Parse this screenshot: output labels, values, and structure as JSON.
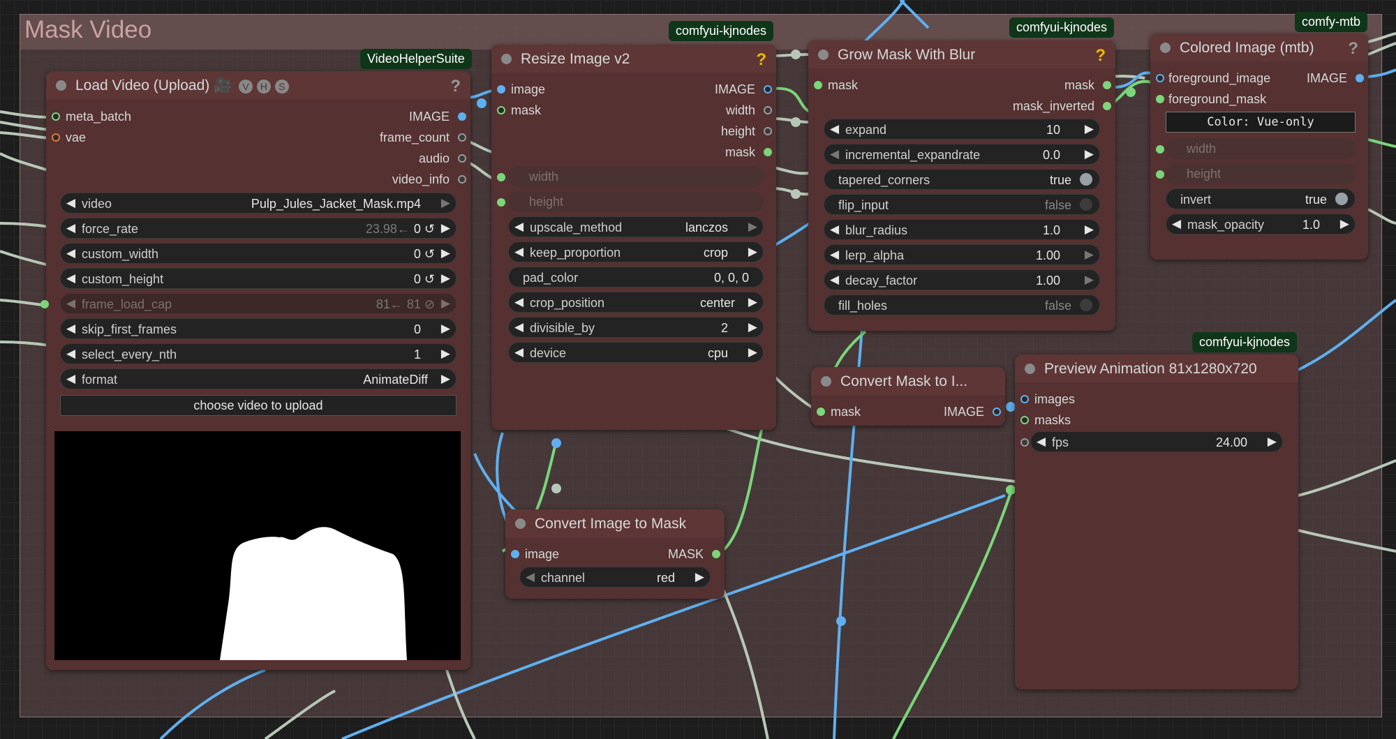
{
  "group": {
    "title": "Mask Video"
  },
  "badges": {
    "vhs": "VideoHelperSuite",
    "kj1": "comfyui-kjnodes",
    "kj2": "comfyui-kjnodes",
    "mtb": "comfy-mtb",
    "kj3": "comfyui-kjnodes"
  },
  "load_video": {
    "title": "Load Video (Upload) 🎥",
    "badge_letters": [
      "V",
      "H",
      "S"
    ],
    "help": "?",
    "inputs": [
      "meta_batch",
      "vae"
    ],
    "outputs": [
      "IMAGE",
      "frame_count",
      "audio",
      "video_info"
    ],
    "widgets": {
      "video": {
        "label": "video",
        "value": "Pulp_Jules_Jacket_Mask.mp4"
      },
      "force_rate": {
        "label": "force_rate",
        "hint": "23.98←",
        "value": "0 ↺"
      },
      "custom_width": {
        "label": "custom_width",
        "value": "0 ↺"
      },
      "custom_height": {
        "label": "custom_height",
        "value": "0 ↺"
      },
      "frame_load_cap": {
        "label": "frame_load_cap",
        "hint": "81←",
        "value": "81 ⊘"
      },
      "skip_first_frames": {
        "label": "skip_first_frames",
        "value": "0"
      },
      "select_every_nth": {
        "label": "select_every_nth",
        "value": "1"
      },
      "format": {
        "label": "format",
        "value": "AnimateDiff"
      }
    },
    "upload_button": "choose video to upload"
  },
  "resize": {
    "title": "Resize Image v2",
    "help": "?",
    "inputs": [
      "image",
      "mask"
    ],
    "outputs": [
      "IMAGE",
      "width",
      "height",
      "mask"
    ],
    "slot_widgets": [
      "width",
      "height"
    ],
    "widgets": {
      "upscale_method": {
        "label": "upscale_method",
        "value": "lanczos"
      },
      "keep_proportion": {
        "label": "keep_proportion",
        "value": "crop"
      },
      "pad_color": {
        "label": "pad_color",
        "value": "0, 0, 0"
      },
      "crop_position": {
        "label": "crop_position",
        "value": "center"
      },
      "divisible_by": {
        "label": "divisible_by",
        "value": "2"
      },
      "device": {
        "label": "device",
        "value": "cpu"
      }
    }
  },
  "grow": {
    "title": "Grow Mask With Blur",
    "help": "?",
    "inputs": [
      "mask"
    ],
    "outputs": [
      "mask",
      "mask_inverted"
    ],
    "widgets": {
      "expand": {
        "label": "expand",
        "value": "10"
      },
      "incremental_expandrate": {
        "label": "incremental_expandrate",
        "value": "0.0"
      },
      "tapered_corners": {
        "label": "tapered_corners",
        "value": "true"
      },
      "flip_input": {
        "label": "flip_input",
        "value": "false"
      },
      "blur_radius": {
        "label": "blur_radius",
        "value": "1.0"
      },
      "lerp_alpha": {
        "label": "lerp_alpha",
        "value": "1.00"
      },
      "decay_factor": {
        "label": "decay_factor",
        "value": "1.00"
      },
      "fill_holes": {
        "label": "fill_holes",
        "value": "false"
      }
    }
  },
  "colored": {
    "title": "Colored Image (mtb)",
    "help": "?",
    "inputs": [
      "foreground_image",
      "foreground_mask"
    ],
    "outputs": [
      "IMAGE"
    ],
    "color_widget": "Color: Vue-only",
    "slot_widgets": [
      "width",
      "height"
    ],
    "widgets": {
      "invert": {
        "label": "invert",
        "value": "true"
      },
      "mask_opacity": {
        "label": "mask_opacity",
        "value": "1.0"
      }
    }
  },
  "convert_mask": {
    "title": "Convert Mask to I...",
    "inputs": [
      "mask"
    ],
    "outputs": [
      "IMAGE"
    ]
  },
  "preview": {
    "title": "Preview Animation 81x1280x720",
    "inputs": [
      "images",
      "masks"
    ],
    "widgets": {
      "fps": {
        "label": "fps",
        "value": "24.00"
      }
    }
  },
  "convert_image": {
    "title": "Convert Image to Mask",
    "inputs": [
      "image"
    ],
    "outputs": [
      "MASK"
    ],
    "widgets": {
      "channel": {
        "label": "channel",
        "value": "red"
      }
    }
  },
  "colors": {
    "node_body": "#553131",
    "node_header": "#5e3636",
    "image_wire": "#5fb0f0",
    "mask_wire": "#7bd67b",
    "badge_bg": "#10361a"
  }
}
